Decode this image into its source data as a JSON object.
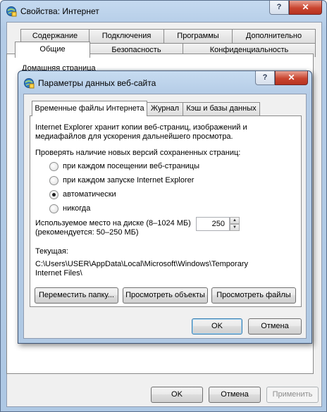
{
  "outer": {
    "title": "Свойства: Интернет",
    "help_glyph": "?",
    "close_glyph": "✕",
    "tabs_row1": [
      "Содержание",
      "Подключения",
      "Программы",
      "Дополнительно"
    ],
    "tabs_row2": [
      "Общие",
      "Безопасность",
      "Конфиденциальность"
    ],
    "home_label": "Домашняя страница",
    "ok": "OK",
    "cancel": "Отмена",
    "apply": "Применить"
  },
  "inner": {
    "title": "Параметры данных веб-сайта",
    "help_glyph": "?",
    "close_glyph": "✕",
    "tabs": [
      "Временные файлы Интернета",
      "Журнал",
      "Кэш и базы данных"
    ],
    "description_line1": "Internet Explorer хранит копии веб-страниц, изображений и",
    "description_line2": "медиафайлов для ускорения дальнейшего просмотра.",
    "check_label": "Проверять наличие новых версий сохраненных страниц:",
    "radios": [
      {
        "label": "при каждом посещении веб-страницы",
        "selected": false
      },
      {
        "label": "при каждом запуске Internet Explorer",
        "selected": false
      },
      {
        "label": "автоматически",
        "selected": true
      },
      {
        "label": "никогда",
        "selected": false
      }
    ],
    "disk_label_line1": "Используемое место на диске (8–1024 МБ)",
    "disk_label_line2": "(рекомендуется: 50–250 МБ)",
    "disk_value": "250",
    "current_label": "Текущая:",
    "current_path_line1": "C:\\Users\\USER\\AppData\\Local\\Microsoft\\Windows\\Temporary",
    "current_path_line2": "Internet Files\\",
    "move_folder": "Переместить папку...",
    "view_objects": "Просмотреть объекты",
    "view_files": "Просмотреть файлы",
    "ok": "OK",
    "cancel": "Отмена"
  },
  "icons": {
    "window_icon": "internet-options-icon",
    "spin_up": "▲",
    "spin_down": "▼"
  }
}
